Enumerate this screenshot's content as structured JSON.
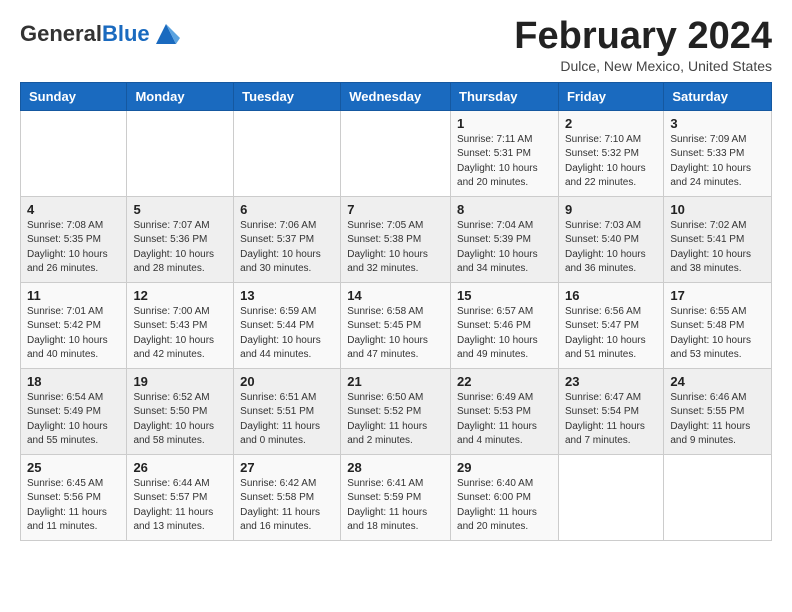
{
  "header": {
    "logo_general": "General",
    "logo_blue": "Blue",
    "month_year": "February 2024",
    "location": "Dulce, New Mexico, United States"
  },
  "weekdays": [
    "Sunday",
    "Monday",
    "Tuesday",
    "Wednesday",
    "Thursday",
    "Friday",
    "Saturday"
  ],
  "weeks": [
    [
      {
        "day": "",
        "info": ""
      },
      {
        "day": "",
        "info": ""
      },
      {
        "day": "",
        "info": ""
      },
      {
        "day": "",
        "info": ""
      },
      {
        "day": "1",
        "info": "Sunrise: 7:11 AM\nSunset: 5:31 PM\nDaylight: 10 hours\nand 20 minutes."
      },
      {
        "day": "2",
        "info": "Sunrise: 7:10 AM\nSunset: 5:32 PM\nDaylight: 10 hours\nand 22 minutes."
      },
      {
        "day": "3",
        "info": "Sunrise: 7:09 AM\nSunset: 5:33 PM\nDaylight: 10 hours\nand 24 minutes."
      }
    ],
    [
      {
        "day": "4",
        "info": "Sunrise: 7:08 AM\nSunset: 5:35 PM\nDaylight: 10 hours\nand 26 minutes."
      },
      {
        "day": "5",
        "info": "Sunrise: 7:07 AM\nSunset: 5:36 PM\nDaylight: 10 hours\nand 28 minutes."
      },
      {
        "day": "6",
        "info": "Sunrise: 7:06 AM\nSunset: 5:37 PM\nDaylight: 10 hours\nand 30 minutes."
      },
      {
        "day": "7",
        "info": "Sunrise: 7:05 AM\nSunset: 5:38 PM\nDaylight: 10 hours\nand 32 minutes."
      },
      {
        "day": "8",
        "info": "Sunrise: 7:04 AM\nSunset: 5:39 PM\nDaylight: 10 hours\nand 34 minutes."
      },
      {
        "day": "9",
        "info": "Sunrise: 7:03 AM\nSunset: 5:40 PM\nDaylight: 10 hours\nand 36 minutes."
      },
      {
        "day": "10",
        "info": "Sunrise: 7:02 AM\nSunset: 5:41 PM\nDaylight: 10 hours\nand 38 minutes."
      }
    ],
    [
      {
        "day": "11",
        "info": "Sunrise: 7:01 AM\nSunset: 5:42 PM\nDaylight: 10 hours\nand 40 minutes."
      },
      {
        "day": "12",
        "info": "Sunrise: 7:00 AM\nSunset: 5:43 PM\nDaylight: 10 hours\nand 42 minutes."
      },
      {
        "day": "13",
        "info": "Sunrise: 6:59 AM\nSunset: 5:44 PM\nDaylight: 10 hours\nand 44 minutes."
      },
      {
        "day": "14",
        "info": "Sunrise: 6:58 AM\nSunset: 5:45 PM\nDaylight: 10 hours\nand 47 minutes."
      },
      {
        "day": "15",
        "info": "Sunrise: 6:57 AM\nSunset: 5:46 PM\nDaylight: 10 hours\nand 49 minutes."
      },
      {
        "day": "16",
        "info": "Sunrise: 6:56 AM\nSunset: 5:47 PM\nDaylight: 10 hours\nand 51 minutes."
      },
      {
        "day": "17",
        "info": "Sunrise: 6:55 AM\nSunset: 5:48 PM\nDaylight: 10 hours\nand 53 minutes."
      }
    ],
    [
      {
        "day": "18",
        "info": "Sunrise: 6:54 AM\nSunset: 5:49 PM\nDaylight: 10 hours\nand 55 minutes."
      },
      {
        "day": "19",
        "info": "Sunrise: 6:52 AM\nSunset: 5:50 PM\nDaylight: 10 hours\nand 58 minutes."
      },
      {
        "day": "20",
        "info": "Sunrise: 6:51 AM\nSunset: 5:51 PM\nDaylight: 11 hours\nand 0 minutes."
      },
      {
        "day": "21",
        "info": "Sunrise: 6:50 AM\nSunset: 5:52 PM\nDaylight: 11 hours\nand 2 minutes."
      },
      {
        "day": "22",
        "info": "Sunrise: 6:49 AM\nSunset: 5:53 PM\nDaylight: 11 hours\nand 4 minutes."
      },
      {
        "day": "23",
        "info": "Sunrise: 6:47 AM\nSunset: 5:54 PM\nDaylight: 11 hours\nand 7 minutes."
      },
      {
        "day": "24",
        "info": "Sunrise: 6:46 AM\nSunset: 5:55 PM\nDaylight: 11 hours\nand 9 minutes."
      }
    ],
    [
      {
        "day": "25",
        "info": "Sunrise: 6:45 AM\nSunset: 5:56 PM\nDaylight: 11 hours\nand 11 minutes."
      },
      {
        "day": "26",
        "info": "Sunrise: 6:44 AM\nSunset: 5:57 PM\nDaylight: 11 hours\nand 13 minutes."
      },
      {
        "day": "27",
        "info": "Sunrise: 6:42 AM\nSunset: 5:58 PM\nDaylight: 11 hours\nand 16 minutes."
      },
      {
        "day": "28",
        "info": "Sunrise: 6:41 AM\nSunset: 5:59 PM\nDaylight: 11 hours\nand 18 minutes."
      },
      {
        "day": "29",
        "info": "Sunrise: 6:40 AM\nSunset: 6:00 PM\nDaylight: 11 hours\nand 20 minutes."
      },
      {
        "day": "",
        "info": ""
      },
      {
        "day": "",
        "info": ""
      }
    ]
  ]
}
